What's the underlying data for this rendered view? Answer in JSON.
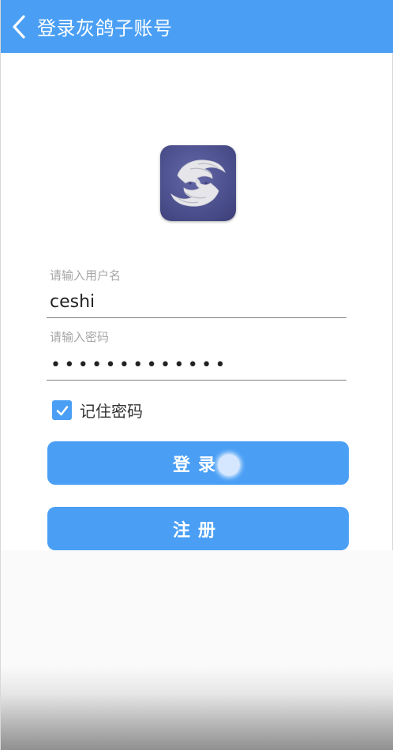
{
  "header": {
    "title": "登录灰鸽子账号",
    "back_icon": "chevron-left-icon"
  },
  "logo": {
    "icon": "bird-logo-icon"
  },
  "form": {
    "username_placeholder": "请输入用户名",
    "username_value": "ceshi",
    "password_placeholder": "请输入密码",
    "password_masked": "•••••••••••••",
    "remember_label": "记住密码",
    "remember_checked": true
  },
  "buttons": {
    "login_label": "登录",
    "register_label": "注册"
  },
  "colors": {
    "accent": "#4a9ff5",
    "logo_bg": "#4b4f8c"
  }
}
